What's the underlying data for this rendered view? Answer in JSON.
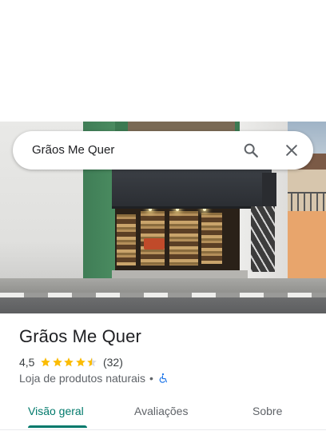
{
  "search": {
    "query": "Grãos Me Quer",
    "search_icon": "search-icon",
    "close_icon": "close-icon"
  },
  "place": {
    "name": "Grãos Me Quer",
    "rating": "4,5",
    "rating_value": 4.5,
    "rating_max": 5,
    "review_count": "(32)",
    "category": "Loja de produtos naturais",
    "separator": "•",
    "accessibility_icon": "wheelchair-icon"
  },
  "tabs": [
    {
      "label": "Visão geral",
      "active": true
    },
    {
      "label": "Avaliações",
      "active": false
    },
    {
      "label": "Sobre",
      "active": false
    }
  ],
  "colors": {
    "accent": "#00796b",
    "star": "#fbbc04",
    "accessibility": "#1a73e8"
  }
}
